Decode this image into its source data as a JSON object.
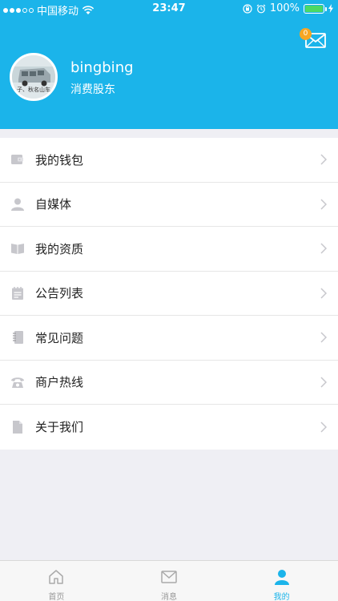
{
  "status_bar": {
    "carrier": "中国移动",
    "time": "23:47",
    "battery": "100%",
    "battery_level": 1.0
  },
  "header": {
    "mail_badge": "0",
    "avatar_caption": "子、秋名山车",
    "username": "bingbing",
    "role": "消费股东"
  },
  "menu": {
    "items": [
      {
        "label": "我的钱包",
        "icon": "wallet-icon"
      },
      {
        "label": "自媒体",
        "icon": "person-icon"
      },
      {
        "label": "我的资质",
        "icon": "book-icon"
      },
      {
        "label": "公告列表",
        "icon": "notepad-icon"
      },
      {
        "label": "常见问题",
        "icon": "notebook-icon"
      },
      {
        "label": "商户热线",
        "icon": "telephone-icon"
      },
      {
        "label": "关于我们",
        "icon": "document-icon"
      }
    ]
  },
  "tabbar": {
    "tabs": [
      {
        "label": "首页",
        "icon": "home-icon",
        "active": false
      },
      {
        "label": "消息",
        "icon": "message-icon",
        "active": false
      },
      {
        "label": "我的",
        "icon": "profile-icon",
        "active": true
      }
    ]
  },
  "colors": {
    "brand": "#1bb4ea",
    "badge": "#f6a623",
    "icon_gray": "#c7c7cc",
    "background": "#efeff4"
  }
}
